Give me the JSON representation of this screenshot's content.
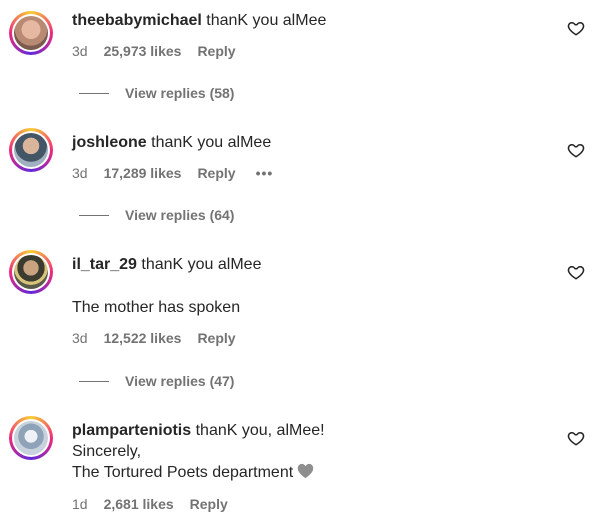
{
  "comments": [
    {
      "username": "theebabymichael",
      "text": "thanK you alMee",
      "time": "3d",
      "likes": "25,973 likes",
      "reply": "Reply",
      "view_replies": "View replies (58)"
    },
    {
      "username": "joshleone",
      "text": "thanK you alMee",
      "time": "3d",
      "likes": "17,289 likes",
      "reply": "Reply",
      "more": "•••",
      "view_replies": "View replies (64)"
    },
    {
      "username": "il_tar_29",
      "text": "thanK you alMee",
      "text2": "The mother has spoken",
      "time": "3d",
      "likes": "12,522 likes",
      "reply": "Reply",
      "view_replies": "View replies (47)"
    },
    {
      "username": "plamparteniotis",
      "text": "thanK you, alMee!",
      "text2": "Sincerely,",
      "text3": "The Tortured Poets department",
      "time": "1d",
      "likes": "2,681 likes",
      "reply": "Reply"
    }
  ],
  "icons": {
    "like": "heart-outline-icon",
    "emoji": "grey-heart-emoji"
  },
  "colors": {
    "secondary_text": "#737373",
    "primary_text": "#262626"
  }
}
